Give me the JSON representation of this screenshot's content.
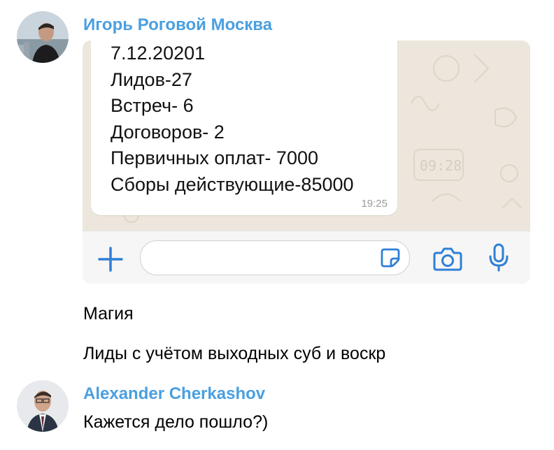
{
  "messages": [
    {
      "sender": "Игорь Роговой Москва",
      "sender_color": "#4a9fe0",
      "avatar_icon": "user-photo-avatar",
      "attachment": {
        "type": "screenshot",
        "bubble_lines": [
          "7.12.20201",
          "Лидов-27",
          "Встреч- 6",
          "Договоров- 2",
          "Первичных оплат- 7000",
          "Сборы действующие-85000"
        ],
        "bubble_time": "19:25",
        "input_bar": {
          "icons": [
            "plus-icon",
            "sticker-icon",
            "camera-icon",
            "microphone-icon"
          ],
          "accent_color": "#2f7fd6"
        }
      },
      "texts": [
        "Магия",
        "Лиды с учётом выходных суб и воскр"
      ]
    },
    {
      "sender": "Alexander Cherkashov",
      "sender_color": "#4a9fe0",
      "avatar_icon": "user-photo-avatar",
      "texts": [
        "Кажется дело пошло?)"
      ]
    }
  ]
}
